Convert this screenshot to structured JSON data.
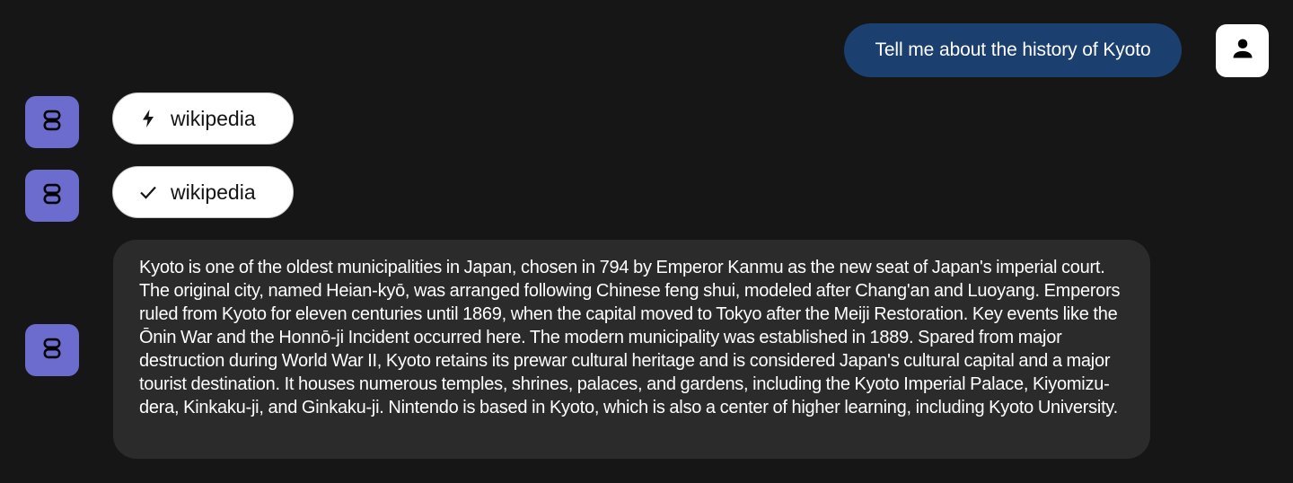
{
  "conversation": {
    "user_message": "Tell me about the history of Kyoto",
    "tool_calls": [
      {
        "status": "running",
        "status_icon": "bolt-icon",
        "label": "wikipedia"
      },
      {
        "status": "done",
        "status_icon": "check-icon",
        "label": "wikipedia"
      }
    ],
    "response": "Kyoto is one of the oldest municipalities in Japan, chosen in 794 by Emperor Kanmu as the new seat of Japan's imperial court. The original city, named Heian-kyō, was arranged following Chinese feng shui, modeled after Chang'an and Luoyang. Emperors ruled from Kyoto for eleven centuries until 1869, when the capital moved to Tokyo after the Meiji Restoration. Key events like the Ōnin War and the Honnō-ji Incident occurred here. The modern municipality was established in 1889. Spared from major destruction during World War II, Kyoto retains its prewar cultural heritage and is considered Japan's cultural capital and a major tourist destination. It houses numerous temples, shrines, palaces, and gardens, including the Kyoto Imperial Palace, Kiyomizu-dera, Kinkaku-ji, and Ginkaku-ji. Nintendo is based in Kyoto, which is also a center of higher learning, including Kyoto University."
  },
  "colors": {
    "background": "#161616",
    "user_bubble": "#1b3f6e",
    "bot_avatar": "#6c6ccf",
    "response_bubble": "#2b2b2b",
    "chip_background": "#ffffff"
  },
  "icons": {
    "user_avatar": "person-icon",
    "bot_avatar": "robot-icon"
  }
}
